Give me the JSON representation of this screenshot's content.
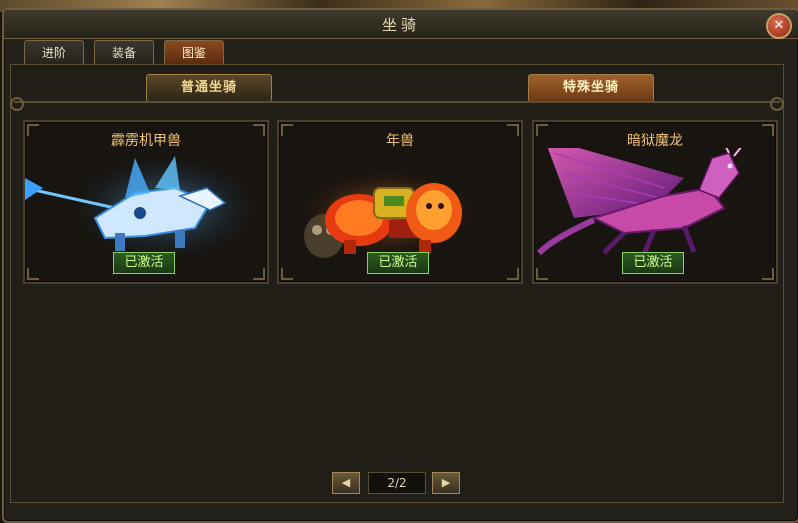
{
  "window": {
    "title": "坐骑"
  },
  "tabs": [
    {
      "label": "进阶",
      "active": false
    },
    {
      "label": "装备",
      "active": false
    },
    {
      "label": "图鉴",
      "active": true
    }
  ],
  "categories": [
    {
      "label": "普通坐骑",
      "active": false
    },
    {
      "label": "特殊坐骑",
      "active": true
    }
  ],
  "mounts": [
    {
      "name": "霹雳机甲兽",
      "status": "已激活",
      "theme": "blue-mech-beast"
    },
    {
      "name": "年兽",
      "status": "已激活",
      "theme": "fire-lion-beast"
    },
    {
      "name": "暗狱魔龙",
      "status": "已激活",
      "theme": "purple-demon-dragon"
    }
  ],
  "pager": {
    "indicator": "2/2",
    "prev_icon": "triangle-left-icon",
    "next_icon": "triangle-right-icon"
  },
  "colors": {
    "accent": "#f2c270",
    "status_green": "#8ad060",
    "frame": "#6b5c3c"
  }
}
